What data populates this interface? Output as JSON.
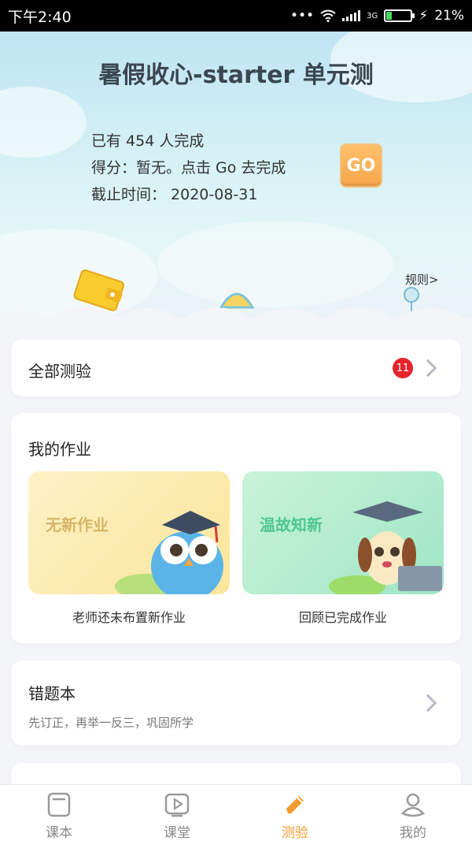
{
  "status_bar": {
    "time": "下午2:40",
    "network": "3G",
    "battery": "21%"
  },
  "hero": {
    "title": "暑假收心-starter 单元测",
    "completed": "已有 454 人完成",
    "score": "得分：暂无。点击 Go 去完成",
    "deadline": "截止时间：  2020-08-31",
    "go_label": "GO",
    "rules_label": "规则>"
  },
  "all_tests": {
    "label": "全部测验",
    "badge_count": "11"
  },
  "homework": {
    "title": "我的作业",
    "tiles": [
      {
        "label": "无新作业",
        "caption": "老师还未布置新作业"
      },
      {
        "label": "温故知新",
        "caption": "回顾已完成作业"
      }
    ]
  },
  "mistakes": {
    "title": "错题本",
    "subtitle": "先订正，再举一反三，巩固所学"
  },
  "tabs": [
    {
      "label": "课本",
      "icon": "book-icon"
    },
    {
      "label": "课堂",
      "icon": "play-icon"
    },
    {
      "label": "测验",
      "icon": "pencil-icon"
    },
    {
      "label": "我的",
      "icon": "profile-icon"
    }
  ],
  "colors": {
    "accent": "#f39a2e",
    "badge": "#e5242a",
    "go_button": "#f6a64b"
  }
}
